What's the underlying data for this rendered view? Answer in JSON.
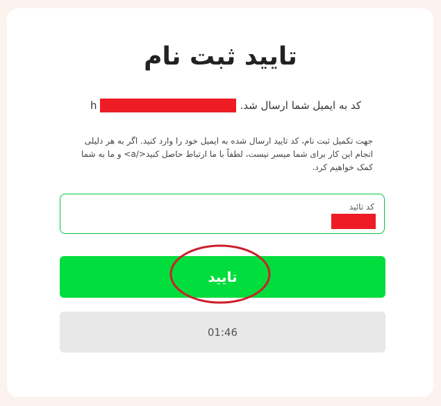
{
  "page": {
    "title": "تایید ثبت نام"
  },
  "sent_message": {
    "text": "کد به ایمیل شما ارسال شد.",
    "email_visible_prefix": "h"
  },
  "instructions": {
    "text": "جهت تکمیل ثبت نام، کد تایید ارسال شده به ایمیل خود را وارد کنید. اگر به هر دلیلی انجام این کار برای شما میسر نیست، لطفاً با ما ارتباط حاصل کنید</a> و ما به شما کمک خواهیم کرد."
  },
  "code_field": {
    "label": "کد تائید"
  },
  "submit_button": {
    "label": "تایید"
  },
  "timer": {
    "value": "01:46"
  },
  "colors": {
    "accent_green": "#00dd3c",
    "field_border": "#00c43a",
    "redaction": "#ee1c25",
    "annotation_circle": "#cc1f2a",
    "timer_bg": "#e8e8e8"
  }
}
